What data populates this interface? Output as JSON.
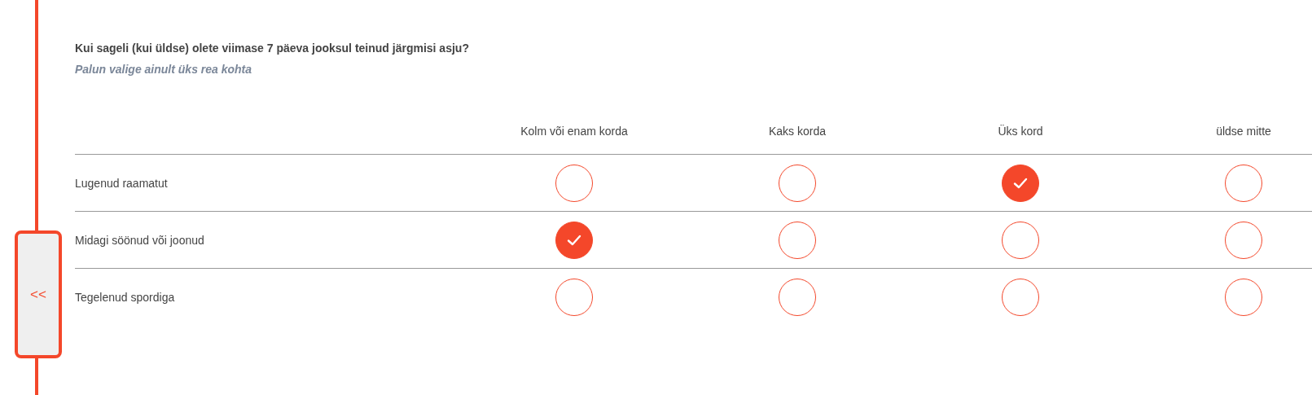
{
  "back_button": {
    "label": "<<"
  },
  "question": {
    "title": "Kui sageli (kui üldse) olete viimase 7 päeva jooksul teinud järgmisi asju?",
    "hint": "Palun valige ainult üks rea kohta"
  },
  "columns": [
    "Kolm või enam korda",
    "Kaks korda",
    "Üks kord",
    "üldse mitte"
  ],
  "rows": [
    {
      "label": "Lugenud raamatut",
      "options": [
        {
          "selected": false
        },
        {
          "selected": false
        },
        {
          "selected": true
        },
        {
          "selected": false
        }
      ]
    },
    {
      "label": "Midagi söönud või joonud",
      "options": [
        {
          "selected": true
        },
        {
          "selected": false
        },
        {
          "selected": false
        },
        {
          "selected": false
        }
      ]
    },
    {
      "label": "Tegelenud spordiga",
      "options": [
        {
          "selected": false
        },
        {
          "selected": false
        },
        {
          "selected": false
        },
        {
          "selected": false
        }
      ]
    }
  ]
}
